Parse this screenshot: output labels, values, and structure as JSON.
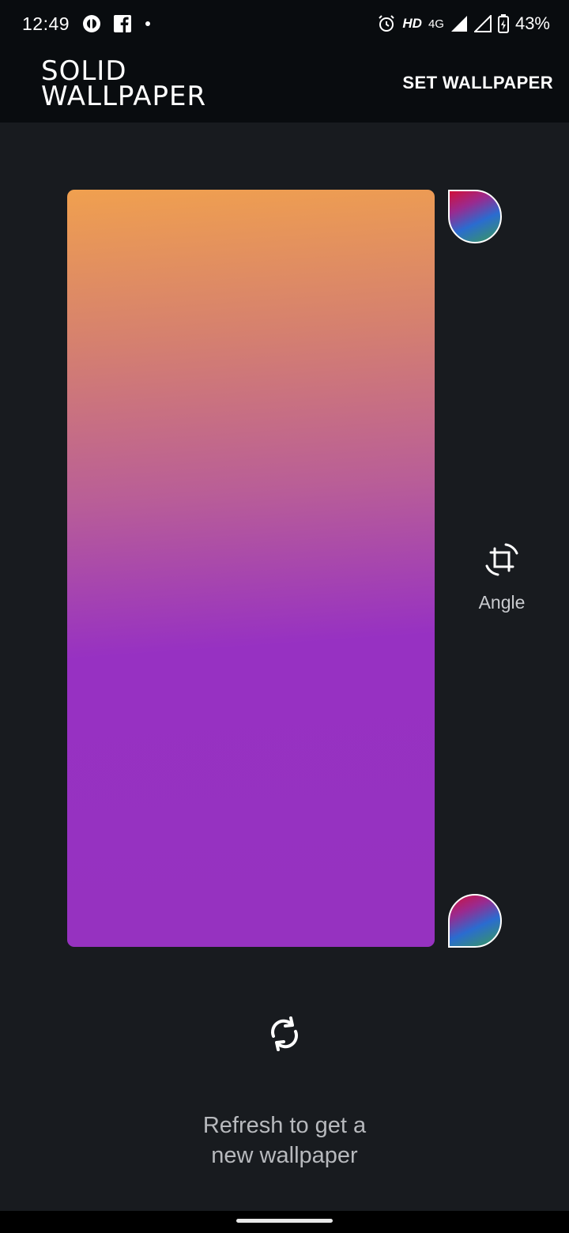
{
  "status_bar": {
    "time": "12:49",
    "network": "4G",
    "hd": "HD",
    "battery": "43%",
    "icons": [
      "app-notification-icon",
      "facebook-icon",
      "dot-icon",
      "alarm-icon",
      "signal-icon",
      "signal-icon",
      "battery-charging-icon"
    ]
  },
  "app_bar": {
    "logo_line1": "SOLID",
    "logo_line2": "WALLPAPER",
    "action": "SET WALLPAPER"
  },
  "preview": {
    "gradient_colors": [
      "#f0a04f",
      "#d5806f",
      "#b95e97",
      "#9731c2",
      "#9632c0"
    ]
  },
  "controls": {
    "angle_label": "Angle",
    "swatch_icons": [
      "color-swatch-start-icon",
      "color-swatch-end-icon"
    ]
  },
  "hint": {
    "line1": "Refresh to get a",
    "line2": "new wallpaper"
  }
}
